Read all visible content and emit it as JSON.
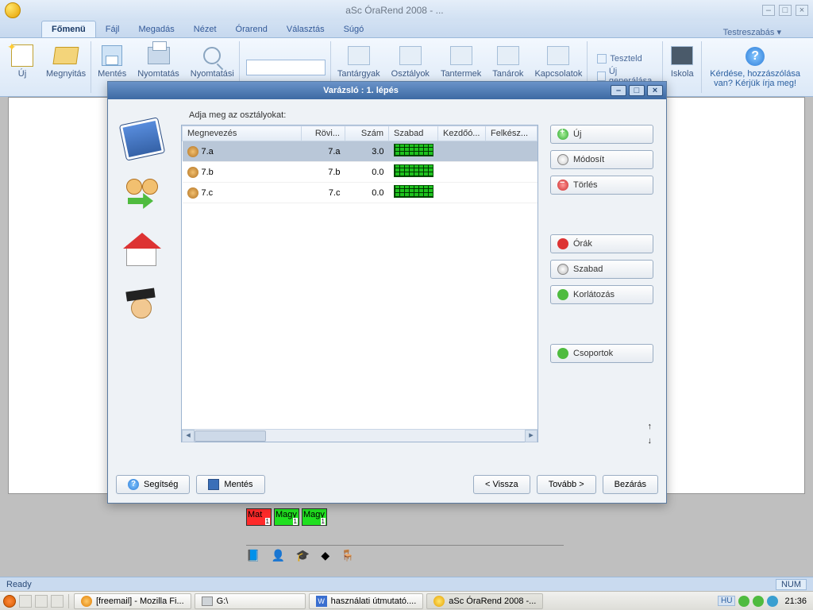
{
  "app": {
    "title": "aSc ÓraRend 2008  - ..."
  },
  "winbtns": {
    "min": "–",
    "max": "□",
    "close": "×"
  },
  "tabs": {
    "main": "Főmenü",
    "file": "Fájl",
    "spec": "Megadás",
    "view": "Nézet",
    "tt": "Órarend",
    "sel": "Választás",
    "help": "Súgó",
    "cust": "Testreszabás ▾"
  },
  "ribbon": {
    "new": "Új",
    "open": "Megnyitás",
    "save": "Mentés",
    "print": "Nyomtatás",
    "ppv": "Nyomtatási",
    "subjects": "Tantárgyak",
    "classes": "Osztályok",
    "rooms": "Tantermek",
    "teachers": "Tanárok",
    "rel": "Kapcsolatok",
    "test": "Teszteld",
    "gen": "Új generálása",
    "school": "Iskola",
    "help_line": "Kérdése, hozzászólása",
    "help_line2": "van? Kérjük írja meg!"
  },
  "dialog": {
    "title": "Varázsló : 1. lépés",
    "instr": "Adja meg az osztályokat:",
    "cols": {
      "name": "Megnevezés",
      "short": "Rövi...",
      "count": "Szám",
      "free": "Szabad",
      "start": "Kezdőó...",
      "prep": "Felkész..."
    },
    "rows": [
      {
        "name": "7.a",
        "short": "7.a",
        "count": "3.0"
      },
      {
        "name": "7.b",
        "short": "7.b",
        "count": "0.0"
      },
      {
        "name": "7.c",
        "short": "7.c",
        "count": "0.0"
      }
    ],
    "btns": {
      "new": "Új",
      "mod": "Módosít",
      "del": "Törlés",
      "ora": "Órák",
      "szabad": "Szabad",
      "korlat": "Korlátozás",
      "csop": "Csoportok"
    },
    "foot": {
      "help": "Segítség",
      "save": "Mentés",
      "back": "< Vissza",
      "next": "Tovább >",
      "close": "Bezárás"
    }
  },
  "lessons": {
    "l1": "Mat",
    "l2": "Magy",
    "l3": "Magy",
    "n": "1"
  },
  "status": {
    "ready": "Ready",
    "num": "NUM"
  },
  "taskbar": {
    "t1": "[freemail] - Mozilla Fi...",
    "t2": "G:\\",
    "t3": "használati útmutató....",
    "t4": "aSc ÓraRend 2008 -...",
    "lang": "HU",
    "clock": "21:36"
  }
}
